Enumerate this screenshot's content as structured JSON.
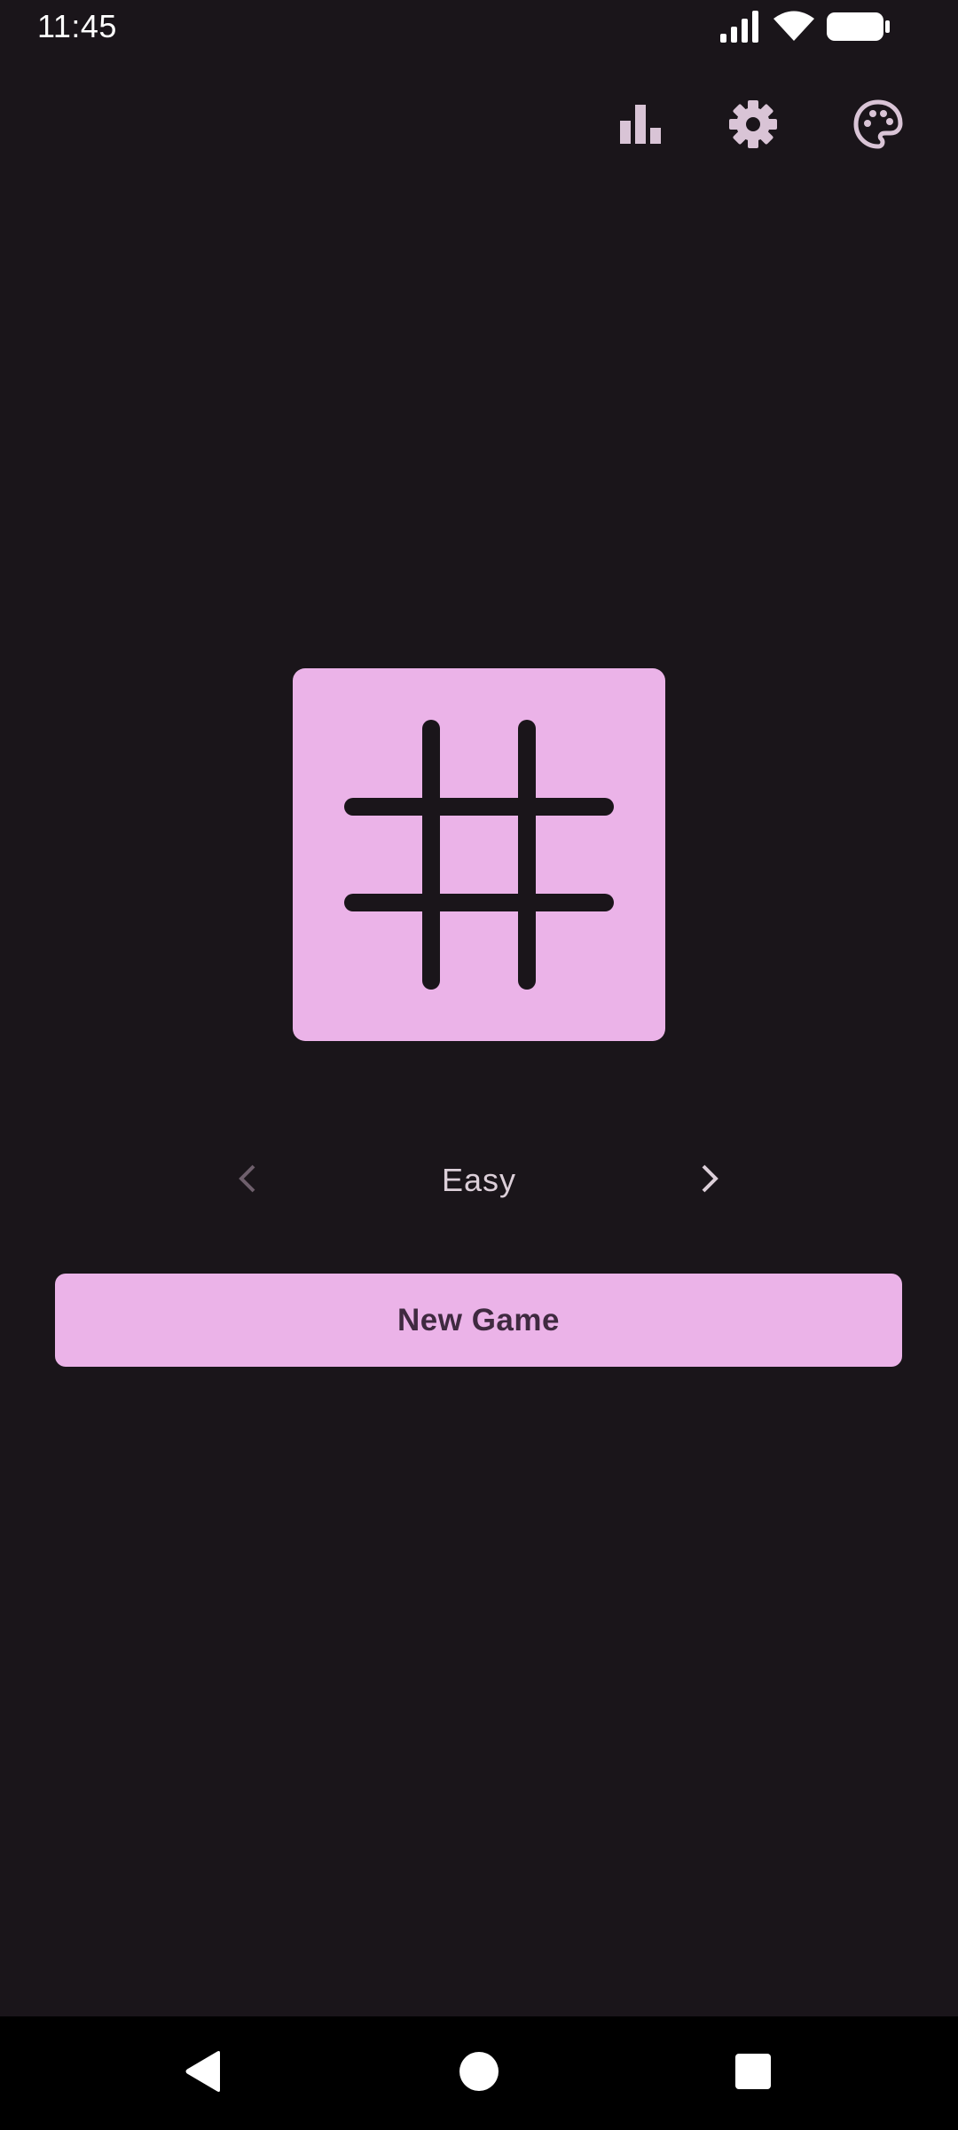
{
  "status_bar": {
    "time": "11:45",
    "icons": [
      "signal-icon",
      "wifi-icon",
      "battery-icon"
    ]
  },
  "toolbar": {
    "icons": [
      "statistics-icon",
      "settings-gear-icon",
      "theme-palette-icon"
    ]
  },
  "logo": {
    "icon": "grid-hash-icon",
    "tile_color": "#ebb3e8",
    "line_color": "#1a151a"
  },
  "difficulty": {
    "label": "Easy",
    "prev_icon": "chevron-left-icon",
    "next_icon": "chevron-right-icon"
  },
  "new_game": {
    "label": "New Game"
  },
  "nav_bar": {
    "icons": [
      "back-icon",
      "home-icon",
      "recents-icon"
    ]
  },
  "colors": {
    "background": "#1a151a",
    "accent": "#ebb3e8",
    "icon": "#d9c4d6",
    "button_text": "#3f2a40"
  }
}
